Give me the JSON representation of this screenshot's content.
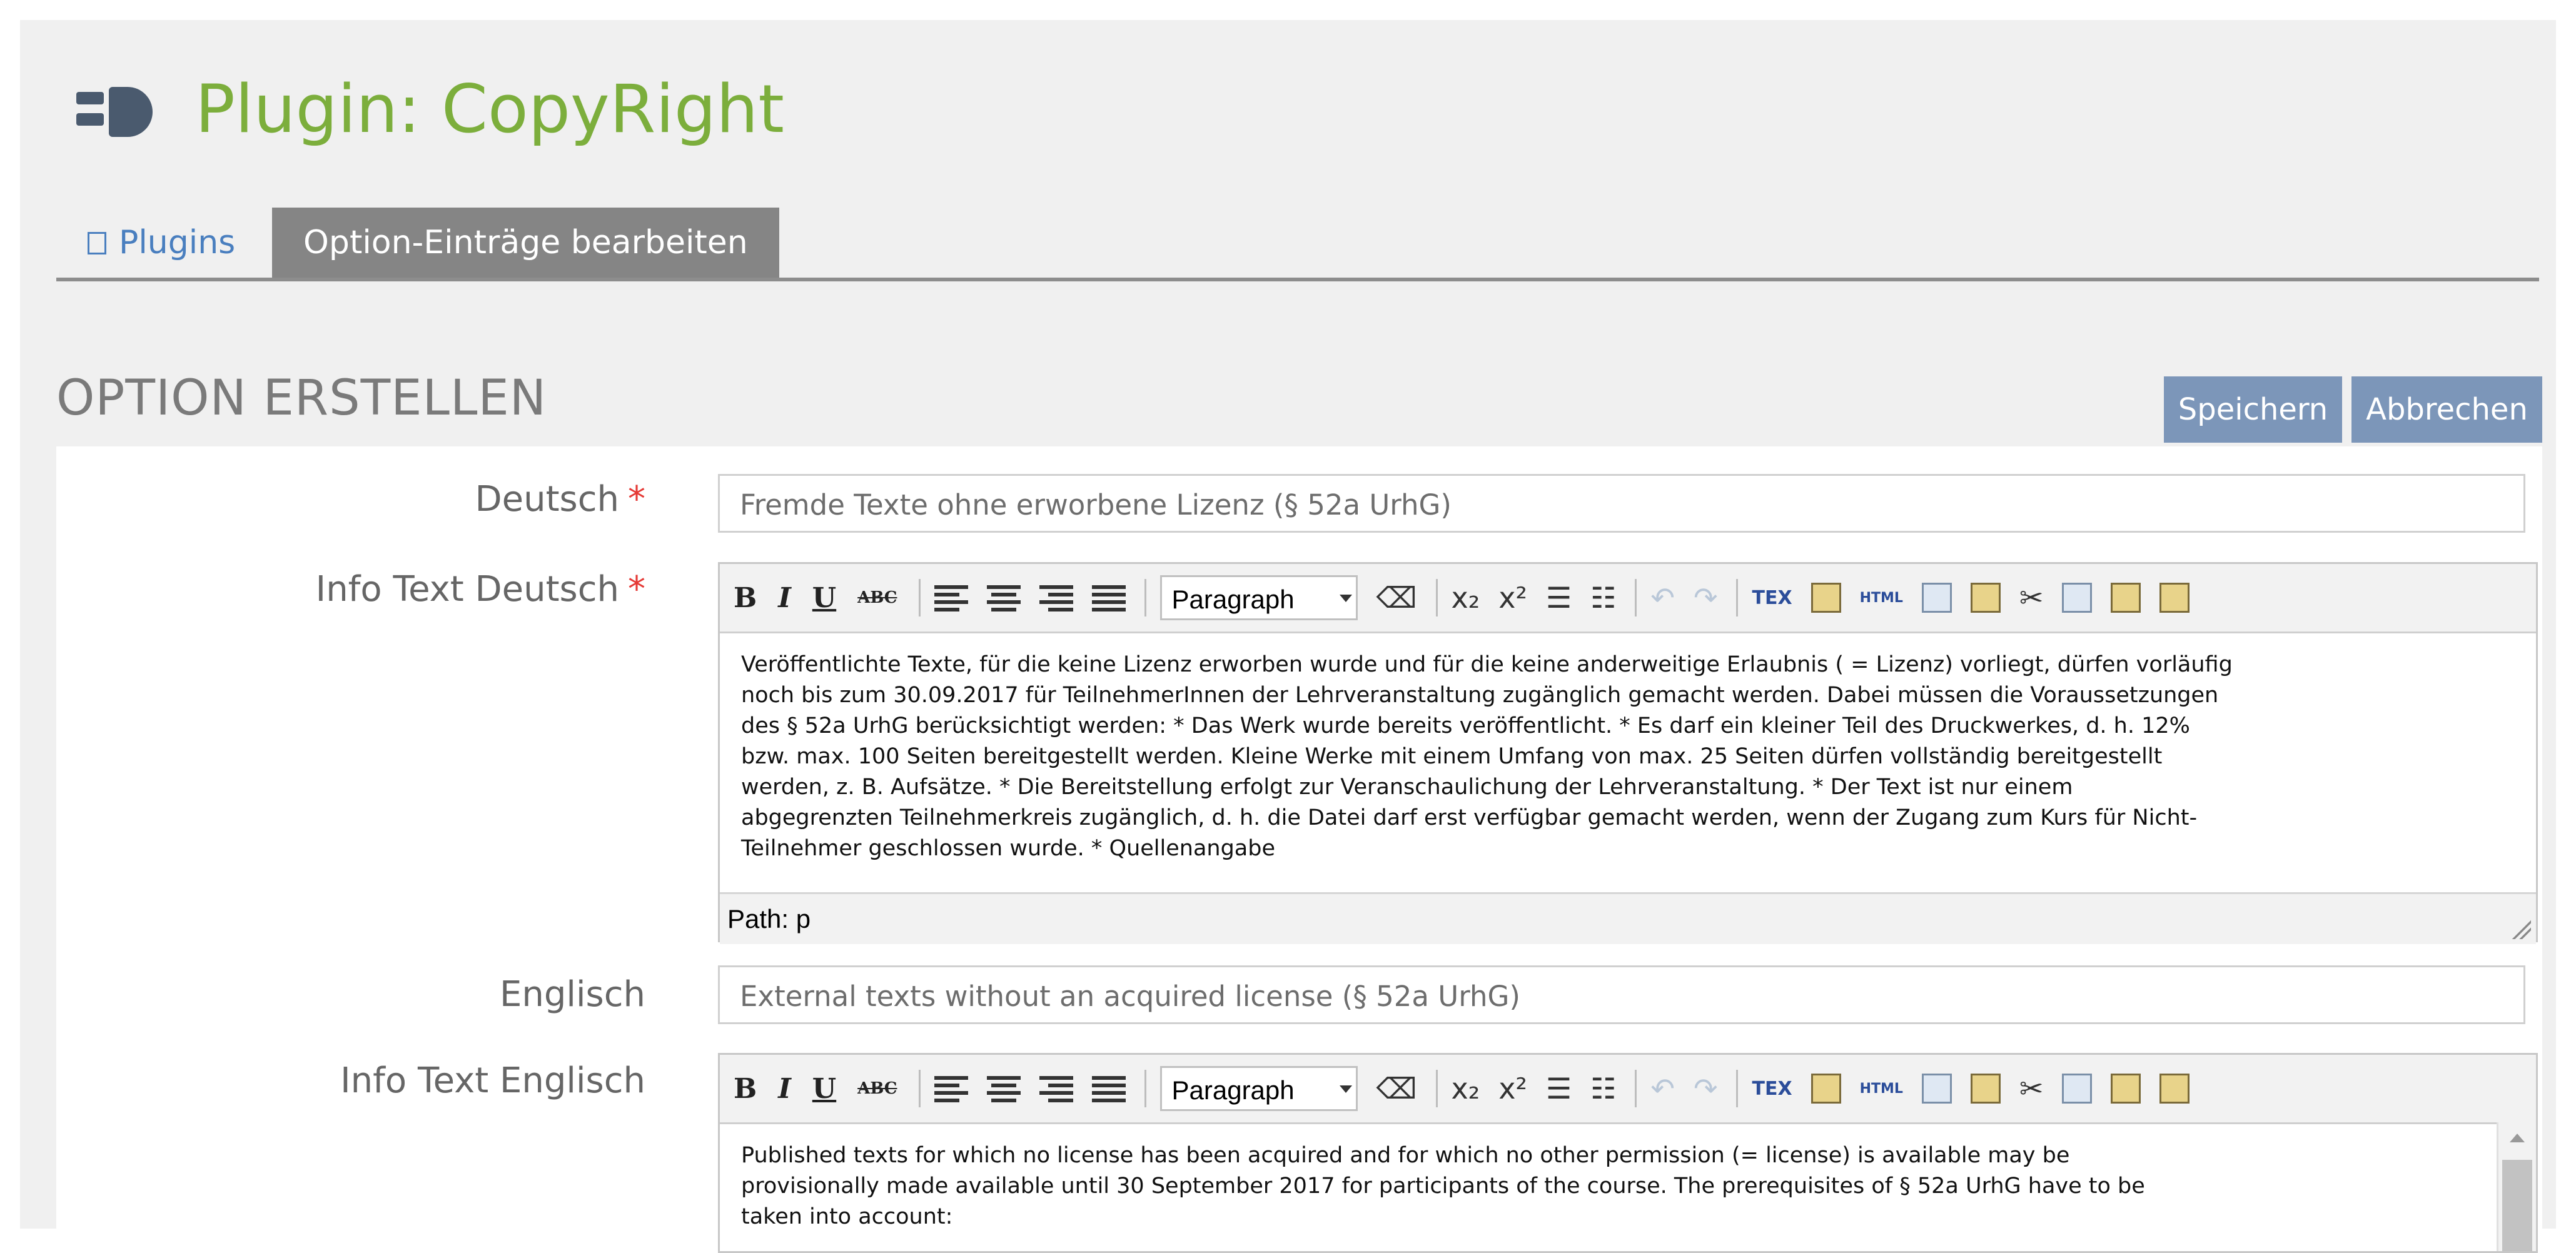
{
  "header": {
    "title": "Plugin: CopyRight",
    "icon": "plugin-icon"
  },
  "tabs": [
    {
      "label": "Plugins",
      "icon": "plugin-glyph-icon"
    },
    {
      "label": "Option-Einträge bearbeiten"
    }
  ],
  "section": {
    "title": "OPTION ERSTELLEN",
    "save_label": "Speichern",
    "cancel_label": "Abbrechen"
  },
  "form": {
    "deutsch": {
      "label": "Deutsch",
      "required": "*",
      "value": "Fremde Texte ohne erworbene Lizenz (§ 52a UrhG)"
    },
    "info_deutsch": {
      "label": "Info Text Deutsch",
      "required": "*",
      "lines": [
        "Veröffentlichte Texte, für die keine Lizenz erworben wurde und für die keine anderweitige Erlaubnis ( = Lizenz) vorliegt, dürfen vorläufig",
        "noch bis zum 30.09.2017 für TeilnehmerInnen der Lehrveranstaltung zugänglich gemacht werden. Dabei müssen die Voraussetzungen",
        "des § 52a UrhG berücksichtigt werden: * Das Werk wurde bereits veröffentlicht. * Es darf ein kleiner Teil des Druckwerkes, d. h. 12%",
        "bzw. max. 100 Seiten bereitgestellt werden. Kleine Werke mit einem Umfang von max. 25 Seiten dürfen vollständig bereitgestellt",
        "werden, z. B. Aufsätze. * Die Bereitstellung erfolgt zur Veranschaulichung der Lehrveranstaltung. * Der Text ist nur einem",
        "abgegrenzten Teilnehmerkreis zugänglich, d. h. die Datei darf erst verfügbar gemacht werden, wenn der Zugang zum Kurs für Nicht-",
        "Teilnehmer geschlossen wurde. * Quellenangabe"
      ],
      "path": "Path: p"
    },
    "englisch": {
      "label": "Englisch",
      "value": "External texts without an acquired license (§ 52a UrhG)"
    },
    "info_englisch": {
      "label": "Info Text Englisch",
      "lines": [
        "Published texts for which no license has been acquired and for which no other permission (= license) is available may be",
        "provisionally made available until 30 September 2017 for participants of the course. The prerequisites of § 52a UrhG have to be",
        "taken into account:"
      ]
    }
  },
  "toolbar": {
    "bold": "B",
    "italic": "I",
    "underline": "U",
    "strike": "ABC",
    "format_select": "Paragraph",
    "subscript": "x₂",
    "superscript": "x²",
    "tex": "TEX",
    "html": "HTML"
  },
  "colors": {
    "title": "#7cae3c",
    "button": "#7c96b9",
    "tab_active": "#858585",
    "required": "#e53935"
  }
}
